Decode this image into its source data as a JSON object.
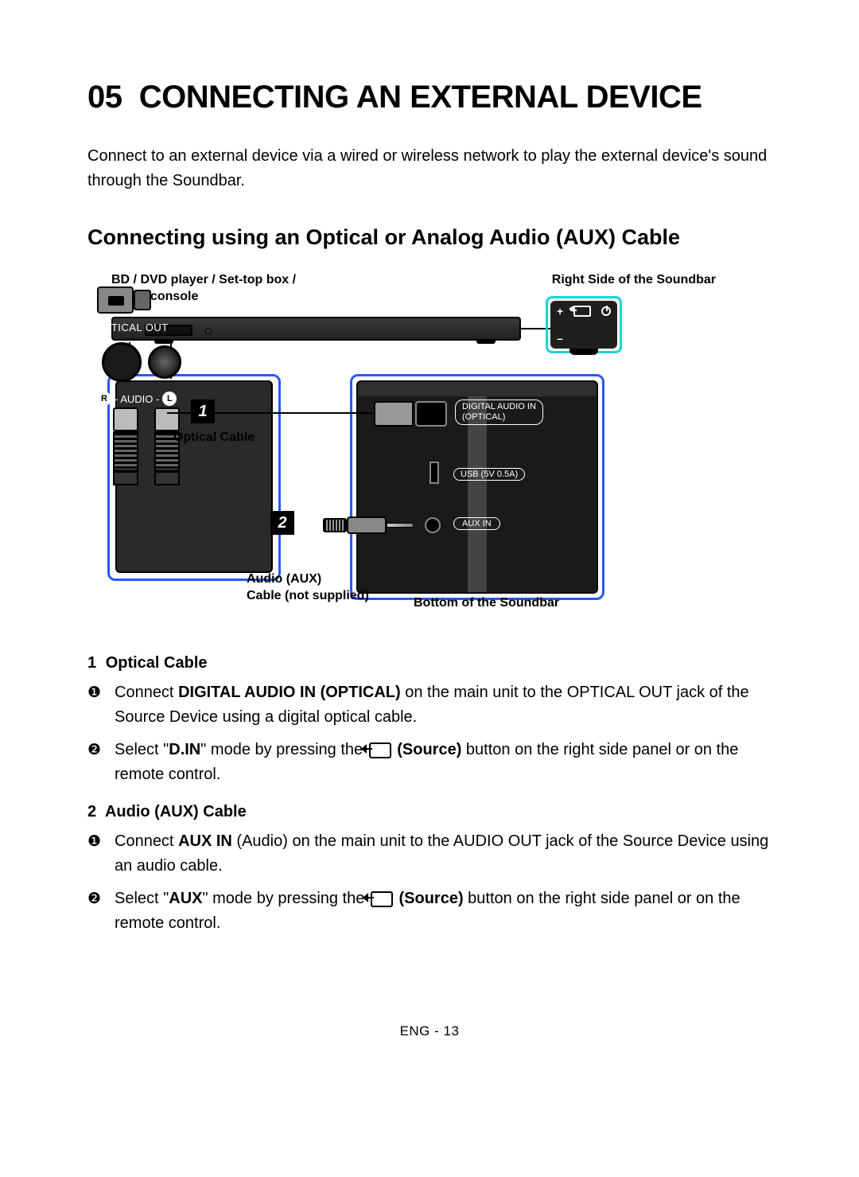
{
  "chapter_number": "05",
  "chapter_title": "CONNECTING AN EXTERNAL DEVICE",
  "intro": "Connect to an external device via a wired or wireless network to play the external device's sound through the Soundbar.",
  "section_title": "Connecting using an Optical or Analog Audio (AUX) Cable",
  "diagram": {
    "top_left_label": "BD / DVD player / Set-top box / Game console",
    "top_right_label": "Right Side of the Soundbar",
    "src_optical_out": "OPTICAL OUT",
    "src_audio_mid": "- AUDIO -",
    "src_audio_r": "R",
    "src_audio_l": "L",
    "num1": "1",
    "num2": "2",
    "cable1_label": "Optical Cable",
    "cable2_label_l1": "Audio (AUX)",
    "cable2_label_l2": "Cable (not supplied)",
    "bottom_label": "Bottom of the Soundbar",
    "port_digital_l1": "DIGITAL AUDIO IN",
    "port_digital_l2": "(OPTICAL)",
    "port_usb": "USB (5V 0.5A)",
    "port_aux": "AUX IN",
    "rp_plus": "+",
    "rp_minus": "–"
  },
  "instructions": [
    {
      "num": "1",
      "heading": "Optical Cable",
      "steps": [
        {
          "marker": "❶",
          "pre": "Connect ",
          "bold1": "DIGITAL AUDIO IN (OPTICAL)",
          "post": " on the main unit to the OPTICAL OUT jack of the Source Device using a digital optical cable."
        },
        {
          "marker": "❷",
          "pre": "Select \"",
          "bold1": "D.IN",
          "post1": "\" mode by pressing the ",
          "source_btn": "(Source)",
          "post2": " button on the right side panel or on the remote control."
        }
      ]
    },
    {
      "num": "2",
      "heading": "Audio (AUX) Cable",
      "steps": [
        {
          "marker": "❶",
          "pre": "Connect ",
          "bold1": "AUX IN",
          "post": " (Audio) on the main unit to the AUDIO OUT jack of the Source Device using an audio cable."
        },
        {
          "marker": "❷",
          "pre": "Select \"",
          "bold1": "AUX",
          "post1": "\" mode by pressing the ",
          "source_btn": "(Source)",
          "post2": " button on the right side panel or on the remote control."
        }
      ]
    }
  ],
  "footer": "ENG - 13"
}
